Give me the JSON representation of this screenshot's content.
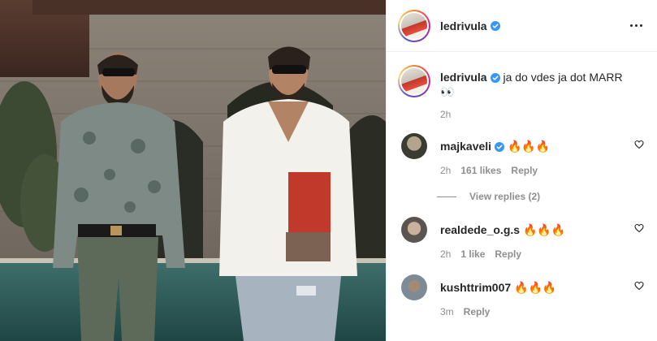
{
  "header": {
    "username": "ledrivula",
    "more_label": "More options"
  },
  "caption": {
    "username": "ledrivula",
    "text": "ja do vdes ja dot MARR",
    "emoji": "👀",
    "time": "2h"
  },
  "comments": [
    {
      "username": "majkaveli",
      "verified": true,
      "text": "🔥🔥🔥",
      "time": "2h",
      "likes": "161 likes",
      "reply": "Reply",
      "view_replies": "View replies (2)"
    },
    {
      "username": "realdede_o.g.s",
      "verified": false,
      "text": "🔥🔥🔥",
      "time": "2h",
      "likes": "1 like",
      "reply": "Reply"
    },
    {
      "username": "kushttrim007",
      "verified": false,
      "text": "🔥🔥🔥",
      "time": "3m",
      "reply": "Reply"
    }
  ],
  "colors": {
    "verified": "#3897f0",
    "muted": "#8e8e8e",
    "text": "#262626"
  },
  "icons": {
    "header": "more-horizontal-icon",
    "comment": "heart-outline-icon",
    "badge": "verified-badge-icon"
  }
}
